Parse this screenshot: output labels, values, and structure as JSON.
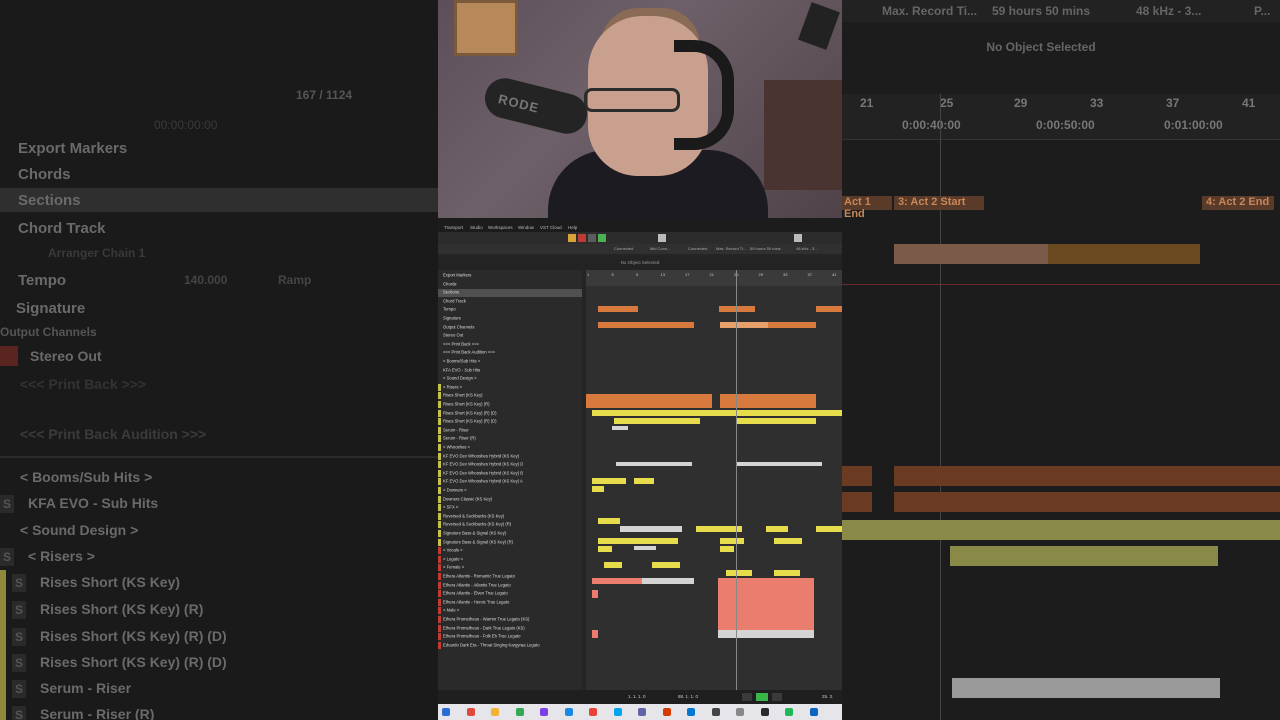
{
  "left_panel": {
    "counter": "167 / 1124",
    "timecode": "00:00:00:00",
    "rows": [
      {
        "label": "Export Markers"
      },
      {
        "label": "Chords"
      },
      {
        "label": "Sections"
      },
      {
        "label": "Chord Track"
      },
      {
        "label": "Arranger Chain 1"
      },
      {
        "label": "Tempo"
      },
      {
        "label": "140.000"
      },
      {
        "label": "Ramp"
      },
      {
        "label": "Signature"
      },
      {
        "label": "Output Channels"
      },
      {
        "label": "Stereo Out"
      },
      {
        "label": "<<< Print Back >>>"
      },
      {
        "label": "<<< Print Back Audition >>>"
      },
      {
        "label": "< Booms/Sub Hits >"
      },
      {
        "label": "KFA EVO - Sub Hits"
      },
      {
        "label": "< Sound Design >"
      },
      {
        "label": "< Risers >"
      },
      {
        "label": "Rises Short (KS Key)"
      },
      {
        "label": "Rises Short (KS Key) (R)"
      },
      {
        "label": "Rises Short (KS Key) (R) (D)"
      },
      {
        "label": "Rises Short (KS Key) (R) (D)"
      },
      {
        "label": "Serum - Riser"
      },
      {
        "label": "Serum - Riser (R)"
      }
    ]
  },
  "right_panel": {
    "status": [
      "Max. Record Ti...",
      "59 hours 50 mins",
      "48 kHz - 3...",
      "P..."
    ],
    "info": "No Object Selected",
    "bars": [
      "21",
      "25",
      "29",
      "33",
      "37",
      "41"
    ],
    "times": [
      "0:00:40:00",
      "0:00:50:00",
      "0:01:00:00"
    ],
    "markers": [
      "Act 1 End",
      "3: Act 2 Start",
      "4: Act 2 End"
    ]
  },
  "webcam": {
    "mic_brand": "RODE"
  },
  "daw": {
    "menu": [
      "Transport",
      "Studio",
      "Workspaces",
      "Window",
      "VST Cloud",
      "Help"
    ],
    "status": [
      "Connected",
      "Mid Conn...",
      "Connected",
      "Max. Record Ti...",
      "59 hours 50 mins",
      "48 kHz - 3..."
    ],
    "info": "No Object Selected",
    "tracks": [
      "Export Markers",
      "Chords",
      "Sections",
      "Chord Track",
      "Tempo",
      "Signature",
      "Output Channels",
      "Stereo Out",
      "<<< Print Back >>>",
      "<<< Print Back Audition >>>",
      "< Booms/Sub Hits >",
      "KFA EVO - Sub Hits",
      "< Sound Design >",
      "< Risers >",
      "Rises Short (KS Key)",
      "Rises Short (KS Key) (R)",
      "Rises Short (KS Key) (R) (D)",
      "Rises Short (KS Key) (R) (D)",
      "Serum - Riser",
      "Serum - Riser (R)",
      "< Whooshes >",
      "KF EVO Dev Whooshes Hybrid (KS Key)",
      "KF EVO Dev Whooshes Hybrid (KS Key) D",
      "KF EVO Dev Whooshes Hybrid (KS Key) B",
      "KF EVO Dev Whooshes Hybrid (KS Key) A",
      "< Downers >",
      "Downers Classic (KS Key)",
      "< SFX >",
      "Reversed & Suckbacks (KS Key)",
      "Reversed & Suckbacks (KS Key) (R)",
      "Signature Bass & Signal (KS Key)",
      "Signature Bass & Signal (KS Key) (R)",
      "< Vocals >",
      "< Legato >",
      "< Female >",
      "Ethera Atlantis - Romantic True Legato",
      "Ethera Atlantis - Atlantis True Legato",
      "Ethera Atlantis - Elven True Legato",
      "Ethera Atlantis - Heroic True Legato",
      "< Male >",
      "Ethera Prometheus - Warrior True Legato (KS)",
      "Ethera Prometheus - Dark True Legato (KS)",
      "Ethera Prometheus - Folk Eh True Legato",
      "Eduardo Dark Era - Throat Singing Kargyraa Legato"
    ],
    "ruler_bars": [
      "1",
      "5",
      "9",
      "13",
      "17",
      "21",
      "25",
      "29",
      "33",
      "37",
      "41"
    ],
    "transport_pos": "1. 1. 1. 0",
    "transport_end": "88. 1. 1. 0",
    "transport_right": "25. 3."
  },
  "colors": {
    "clip_yellow": "#e6dc4c",
    "clip_orange": "#d8793d",
    "clip_salmon": "#ea7d6d",
    "clip_grey": "#d4d4d4",
    "accent_red": "#c23b32"
  }
}
